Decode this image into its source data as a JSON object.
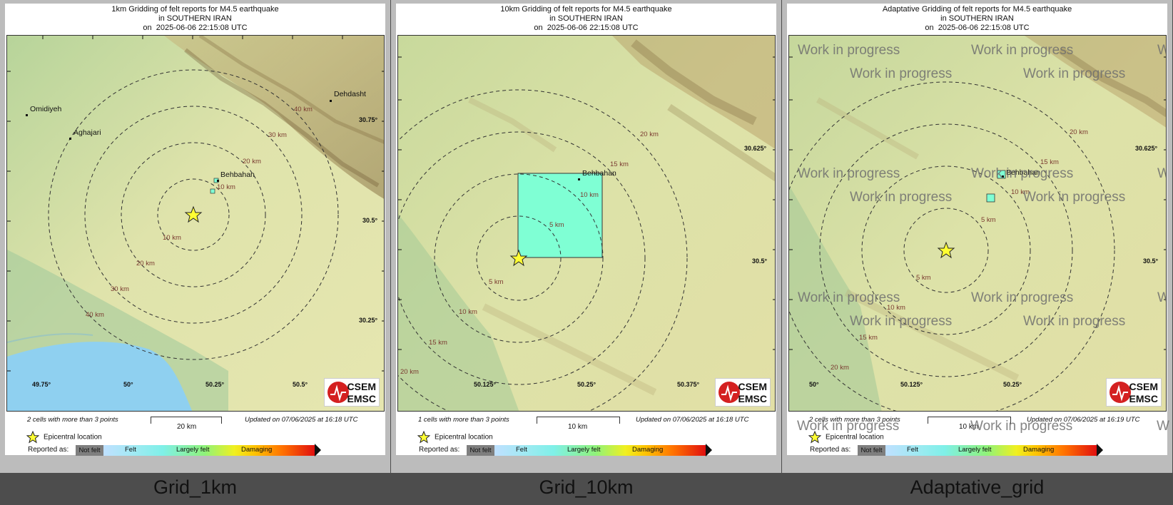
{
  "panels": [
    {
      "title": [
        "1km Gridding of felt reports for M4.5 earthquake",
        "in SOUTHERN IRAN",
        "on  2025-06-06 22:15:08 UTC"
      ],
      "cities": [
        {
          "name": "Omidiyeh"
        },
        {
          "name": "Aghajari"
        },
        {
          "name": "Behbahan"
        },
        {
          "name": "Dehdasht"
        }
      ],
      "ring_labels": [
        "10 km",
        "10 km",
        "20 km",
        "20 km",
        "30 km",
        "30 km",
        "40 km",
        "40 km"
      ],
      "lon_ticks": [
        "49.75°",
        "50°",
        "50.25°",
        "50.5°"
      ],
      "lat_ticks": [
        "30.75°",
        "30.5°",
        "30.25°"
      ],
      "cells_text": "2 cells with more than 3 points",
      "scale_label": "20 km",
      "updated": "Updated on 07/06/2025 at 16:18 UTC",
      "wip": [],
      "caption": "Grid_1km"
    },
    {
      "title": [
        "10km Gridding of felt reports for M4.5 earthquake",
        "in SOUTHERN IRAN",
        "on  2025-06-06 22:15:08 UTC"
      ],
      "cities": [
        {
          "name": "Behbahan"
        }
      ],
      "ring_labels": [
        "5 km",
        "5 km",
        "10 km",
        "10 km",
        "15 km",
        "15 km",
        "20 km",
        "20 km"
      ],
      "lon_ticks": [
        "50.125°",
        "50.25°",
        "50.375°"
      ],
      "lat_ticks": [
        "30.625°",
        "30.5°"
      ],
      "cells_text": "1 cells with more than 3 points",
      "scale_label": "10 km",
      "updated": "Updated on 07/06/2025 at 16:18 UTC",
      "wip": [],
      "caption": "Grid_10km"
    },
    {
      "title": [
        "Adaptative Gridding of felt reports for M4.5 earthquake",
        "in SOUTHERN IRAN",
        "on  2025-06-06 22:15:08 UTC"
      ],
      "cities": [
        {
          "name": "Behbahan"
        }
      ],
      "ring_labels": [
        "5 km",
        "5 km",
        "10 km",
        "10 km",
        "15 km",
        "15 km",
        "20 km",
        "20 km"
      ],
      "lon_ticks": [
        "50°",
        "50.125°",
        "50.25°"
      ],
      "lat_ticks": [
        "30.625°",
        "30.5°"
      ],
      "cells_text": "2 cells with more than 3 points",
      "scale_label": "10 km",
      "updated": "Updated on 07/06/2025 at 16:19 UTC",
      "wip": [
        "Work in progress",
        "Work in progress",
        "Work in progress",
        "Work in progress",
        "Work in progress",
        "Work in progress",
        "Work in progress",
        "Work in progress",
        "Work in progress",
        "Work in progress",
        "Work in progress",
        "Work in progress",
        "Work in progress",
        "Work in progress",
        "W",
        "W",
        "W",
        "W"
      ],
      "caption": "Adaptative_grid"
    }
  ],
  "legend": {
    "epicentral": "Epicentral location",
    "reported_as": "Reported as:",
    "not_felt": "Not felt",
    "felt": "Felt",
    "largely_felt": "Largely felt",
    "damaging": "Damaging"
  },
  "logo": {
    "line1": "CSEM",
    "line2": "EMSC"
  },
  "colors": {
    "cell": "#7fffd4",
    "star": "#ffff33",
    "sea": "#8fd0f0",
    "terrain": "#d9dfa6"
  }
}
